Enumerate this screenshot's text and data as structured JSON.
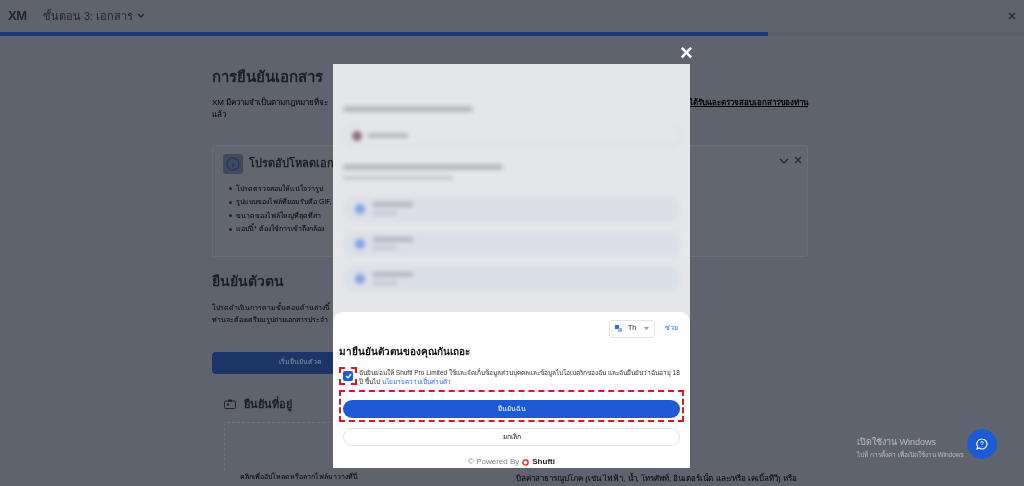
{
  "header": {
    "logo": "XM",
    "step": "ขั้นตอน 3: เอกสาร",
    "progress": {
      "level": 0.75
    }
  },
  "documents": {
    "title": "การยืนยันเอกสาร",
    "intro": "XM มีความจำเป็นตามกฎหมายที่จะ",
    "intro_link": "ได้รับและตรวจสอบเอกสารของท่าน",
    "intro_end": "แล้ว"
  },
  "notice": {
    "title": "โปรดอัปโหลดเอก",
    "expanded": true,
    "bullets": [
      "โปรดตรวจสอบให้แน่ใจว่ารูป",
      "รูปแบบของไฟล์ที่ยอมรับคือ GIF,",
      "ขนาดของไฟล์ใหญ่ที่สุดที่สา",
      "แอปนี้* ต้องใช้การเข้าถึงกล้อง"
    ]
  },
  "identity": {
    "title": "ยืนยันตัวตน",
    "lines": [
      "โปรดดำเนินการตามขั้นตอนด้านล่างนี้",
      "ท่านจะต้องเตรียมรูปถ่ายเอกสารประจำ"
    ],
    "button": "เริ่มยืนยันตัวต"
  },
  "address": {
    "title": "ยืนยันที่อยู่",
    "upload_hint": "คลิกเพื่ออัปโหลดหรือลากไฟล์มาวางที่นี่",
    "note": "บิลค่าสาธารณูปโภค (เช่น ไฟฟ้า, น้ำ, โทรศัพท์, อินเตอร์เน็ต และ/หรือ เคเบิ้ลทีวี) หรือ"
  },
  "modal": {
    "close": "×",
    "language": "Th",
    "help": "ช่วย",
    "title": "มายืนยันตัวตนของคุณกันเถอะ",
    "consent": {
      "checked": true,
      "highlighted": true,
      "text": "ฉันยินยอมให้ Shufti Pro Limited ใช้และจัดเก็บข้อมูลส่วนบุคคลและข้อมูลไบโอเมตริกของฉัน และฉันยืนยันว่าฉันอายุ 18 ปี ขึ้นไป",
      "link": "นโยบายความเป็นส่วนตัว"
    },
    "confirm": {
      "label": "ยืนยันฉัน",
      "highlighted": true
    },
    "cancel": {
      "label": "ยกเลิก",
      "highlighted": false
    },
    "powered": "© Powered By",
    "brand": "Shufti"
  },
  "windows": {
    "title": "เปิดใช้งาน Windows",
    "subtitle": "ไปที่ การตั้งค่า เพื่อเปิดใช้งาน Windows"
  }
}
